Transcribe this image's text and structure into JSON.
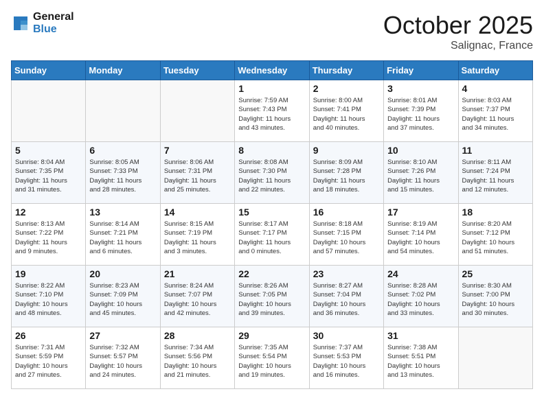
{
  "logo": {
    "line1": "General",
    "line2": "Blue"
  },
  "title": "October 2025",
  "location": "Salignac, France",
  "days_of_week": [
    "Sunday",
    "Monday",
    "Tuesday",
    "Wednesday",
    "Thursday",
    "Friday",
    "Saturday"
  ],
  "weeks": [
    [
      {
        "day": "",
        "info": ""
      },
      {
        "day": "",
        "info": ""
      },
      {
        "day": "",
        "info": ""
      },
      {
        "day": "1",
        "info": "Sunrise: 7:59 AM\nSunset: 7:43 PM\nDaylight: 11 hours\nand 43 minutes."
      },
      {
        "day": "2",
        "info": "Sunrise: 8:00 AM\nSunset: 7:41 PM\nDaylight: 11 hours\nand 40 minutes."
      },
      {
        "day": "3",
        "info": "Sunrise: 8:01 AM\nSunset: 7:39 PM\nDaylight: 11 hours\nand 37 minutes."
      },
      {
        "day": "4",
        "info": "Sunrise: 8:03 AM\nSunset: 7:37 PM\nDaylight: 11 hours\nand 34 minutes."
      }
    ],
    [
      {
        "day": "5",
        "info": "Sunrise: 8:04 AM\nSunset: 7:35 PM\nDaylight: 11 hours\nand 31 minutes."
      },
      {
        "day": "6",
        "info": "Sunrise: 8:05 AM\nSunset: 7:33 PM\nDaylight: 11 hours\nand 28 minutes."
      },
      {
        "day": "7",
        "info": "Sunrise: 8:06 AM\nSunset: 7:31 PM\nDaylight: 11 hours\nand 25 minutes."
      },
      {
        "day": "8",
        "info": "Sunrise: 8:08 AM\nSunset: 7:30 PM\nDaylight: 11 hours\nand 22 minutes."
      },
      {
        "day": "9",
        "info": "Sunrise: 8:09 AM\nSunset: 7:28 PM\nDaylight: 11 hours\nand 18 minutes."
      },
      {
        "day": "10",
        "info": "Sunrise: 8:10 AM\nSunset: 7:26 PM\nDaylight: 11 hours\nand 15 minutes."
      },
      {
        "day": "11",
        "info": "Sunrise: 8:11 AM\nSunset: 7:24 PM\nDaylight: 11 hours\nand 12 minutes."
      }
    ],
    [
      {
        "day": "12",
        "info": "Sunrise: 8:13 AM\nSunset: 7:22 PM\nDaylight: 11 hours\nand 9 minutes."
      },
      {
        "day": "13",
        "info": "Sunrise: 8:14 AM\nSunset: 7:21 PM\nDaylight: 11 hours\nand 6 minutes."
      },
      {
        "day": "14",
        "info": "Sunrise: 8:15 AM\nSunset: 7:19 PM\nDaylight: 11 hours\nand 3 minutes."
      },
      {
        "day": "15",
        "info": "Sunrise: 8:17 AM\nSunset: 7:17 PM\nDaylight: 11 hours\nand 0 minutes."
      },
      {
        "day": "16",
        "info": "Sunrise: 8:18 AM\nSunset: 7:15 PM\nDaylight: 10 hours\nand 57 minutes."
      },
      {
        "day": "17",
        "info": "Sunrise: 8:19 AM\nSunset: 7:14 PM\nDaylight: 10 hours\nand 54 minutes."
      },
      {
        "day": "18",
        "info": "Sunrise: 8:20 AM\nSunset: 7:12 PM\nDaylight: 10 hours\nand 51 minutes."
      }
    ],
    [
      {
        "day": "19",
        "info": "Sunrise: 8:22 AM\nSunset: 7:10 PM\nDaylight: 10 hours\nand 48 minutes."
      },
      {
        "day": "20",
        "info": "Sunrise: 8:23 AM\nSunset: 7:09 PM\nDaylight: 10 hours\nand 45 minutes."
      },
      {
        "day": "21",
        "info": "Sunrise: 8:24 AM\nSunset: 7:07 PM\nDaylight: 10 hours\nand 42 minutes."
      },
      {
        "day": "22",
        "info": "Sunrise: 8:26 AM\nSunset: 7:05 PM\nDaylight: 10 hours\nand 39 minutes."
      },
      {
        "day": "23",
        "info": "Sunrise: 8:27 AM\nSunset: 7:04 PM\nDaylight: 10 hours\nand 36 minutes."
      },
      {
        "day": "24",
        "info": "Sunrise: 8:28 AM\nSunset: 7:02 PM\nDaylight: 10 hours\nand 33 minutes."
      },
      {
        "day": "25",
        "info": "Sunrise: 8:30 AM\nSunset: 7:00 PM\nDaylight: 10 hours\nand 30 minutes."
      }
    ],
    [
      {
        "day": "26",
        "info": "Sunrise: 7:31 AM\nSunset: 5:59 PM\nDaylight: 10 hours\nand 27 minutes."
      },
      {
        "day": "27",
        "info": "Sunrise: 7:32 AM\nSunset: 5:57 PM\nDaylight: 10 hours\nand 24 minutes."
      },
      {
        "day": "28",
        "info": "Sunrise: 7:34 AM\nSunset: 5:56 PM\nDaylight: 10 hours\nand 21 minutes."
      },
      {
        "day": "29",
        "info": "Sunrise: 7:35 AM\nSunset: 5:54 PM\nDaylight: 10 hours\nand 19 minutes."
      },
      {
        "day": "30",
        "info": "Sunrise: 7:37 AM\nSunset: 5:53 PM\nDaylight: 10 hours\nand 16 minutes."
      },
      {
        "day": "31",
        "info": "Sunrise: 7:38 AM\nSunset: 5:51 PM\nDaylight: 10 hours\nand 13 minutes."
      },
      {
        "day": "",
        "info": ""
      }
    ]
  ]
}
